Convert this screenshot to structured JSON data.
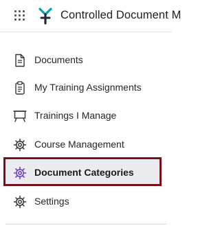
{
  "header": {
    "app_title": "Controlled Document M",
    "launcher_icon": "grid-icon",
    "logo_icon": "brand-logo-icon",
    "logo_color": "#00a0a8",
    "logo_dark_color": "#1f2a35"
  },
  "nav": {
    "items": [
      {
        "label": "Documents",
        "icon": "document-icon"
      },
      {
        "label": "My Training Assignments",
        "icon": "clipboard-icon"
      },
      {
        "label": "Trainings I Manage",
        "icon": "presentation-board-icon"
      },
      {
        "label": "Course Management",
        "icon": "gear-icon"
      },
      {
        "label": "Document Categories",
        "icon": "gear-icon",
        "active": true,
        "icon_color": "#6c3fc7"
      },
      {
        "label": "Settings",
        "icon": "gear-icon"
      }
    ]
  },
  "colors": {
    "highlight_border": "#7a0f17",
    "active_background": "#ececf0"
  }
}
